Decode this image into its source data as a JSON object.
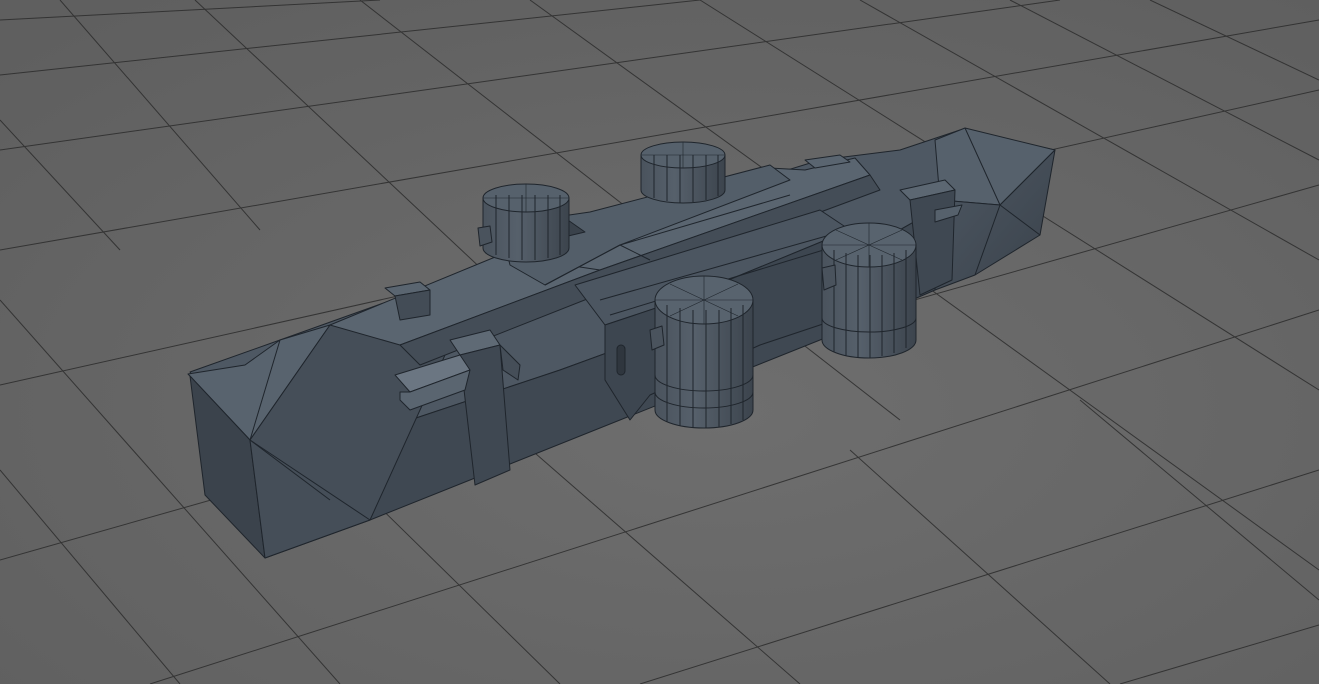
{
  "viewport": {
    "background_color": "#6a6a6a",
    "grid_line_color": "#2c2c2c",
    "grid_visible": true
  },
  "model": {
    "wireframe_color": "#1f252c",
    "shade_light": "#5e6975",
    "shade_mid": "#4b5560",
    "shade_dark": "#3d4650",
    "shade_darkest": "#323941",
    "cylinder_count": 4
  }
}
